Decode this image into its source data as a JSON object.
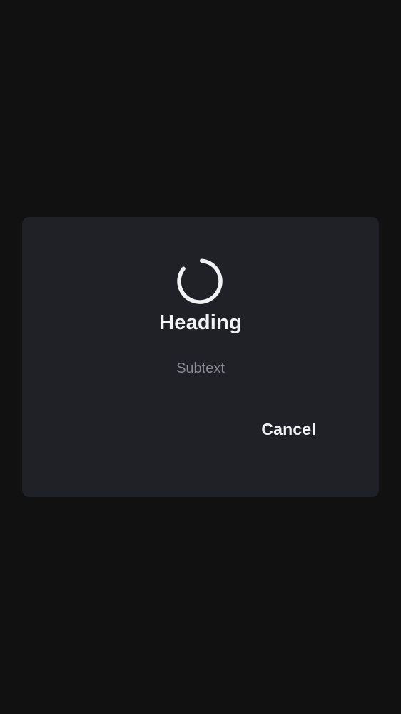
{
  "dialog": {
    "heading": "Heading",
    "subtext": "Subtext",
    "cancel_label": "Cancel"
  },
  "spinner": {
    "icon": "loading-spinner-icon",
    "color": "#f2f2f4"
  },
  "colors": {
    "background": "#111112",
    "dialog": "#202127",
    "heading": "#f2f2f4",
    "subtext": "#8a8c95"
  }
}
